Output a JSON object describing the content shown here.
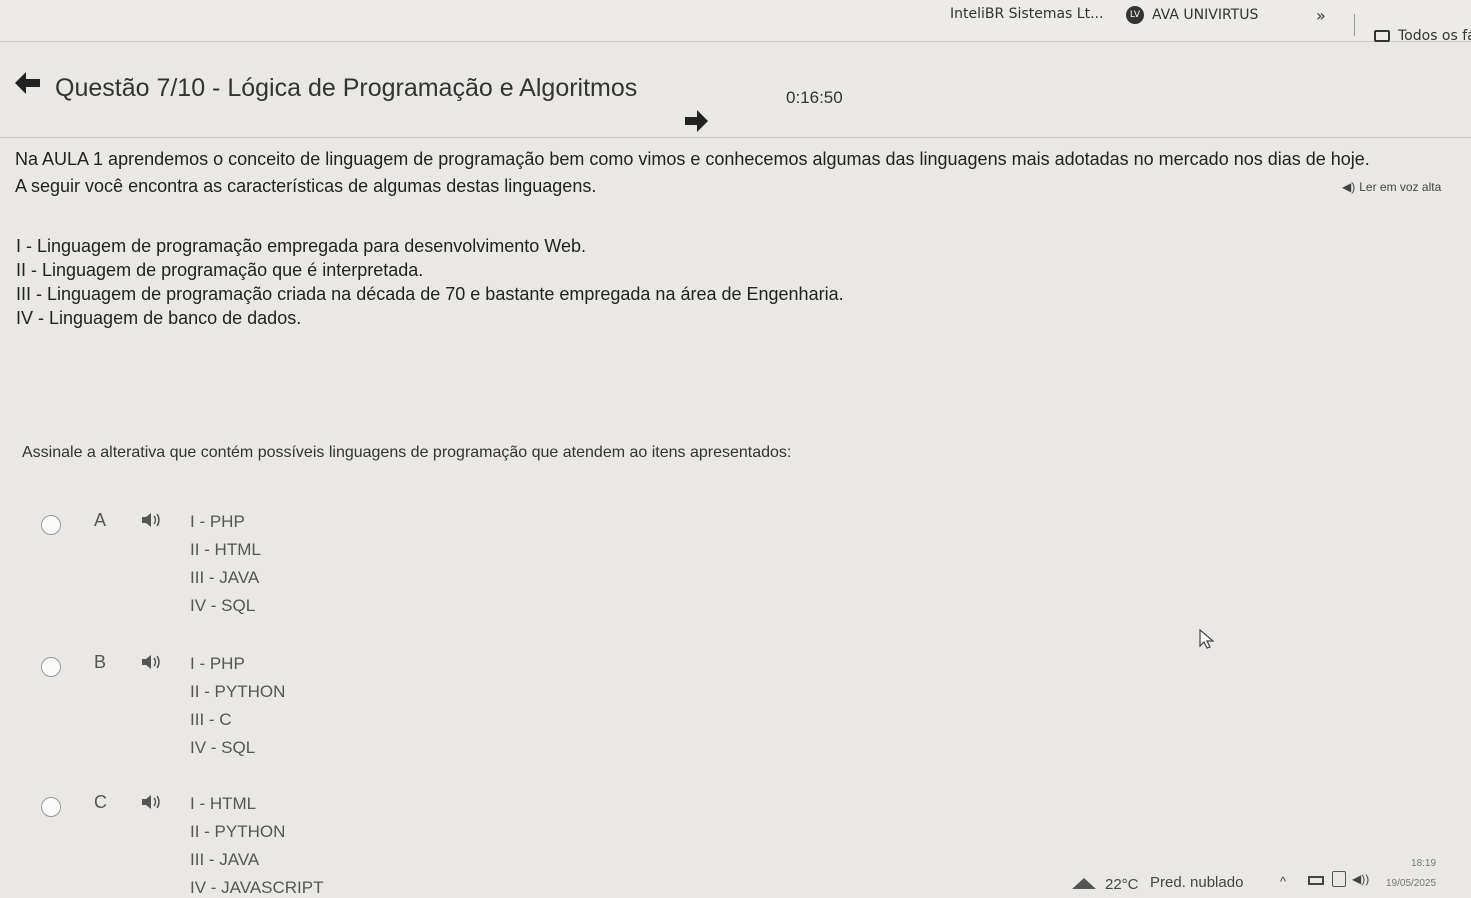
{
  "bookmarks": {
    "item1": "InteliBR Sistemas Lt...",
    "item2_icon": "LV",
    "item2": "AVA UNIVIRTUS",
    "more": "»",
    "item3": "Todos os fa"
  },
  "header": {
    "title": "Questão 7/10 - Lógica de Programação e Algoritmos",
    "timer": "0:16:50"
  },
  "question": {
    "intro_line1": "Na AULA 1 aprendemos o conceito de linguagem de programação bem como vimos e conhecemos algumas das linguagens mais adotadas no mercado nos dias de hoje.",
    "intro_line2": "A seguir você encontra as características de algumas destas linguagens.",
    "tts_label": "Ler em voz alta",
    "items": [
      "I - Linguagem de programação empregada para desenvolvimento Web.",
      "II - Linguagem de programação que é interpretada.",
      "III - Linguagem de programação criada na década de 70 e bastante empregada na área de Engenharia.",
      "IV - Linguagem de banco de dados."
    ],
    "prompt": "Assinale a alterativa que contém possíveis linguagens de programação que atendem ao itens apresentados:"
  },
  "options": [
    {
      "letter": "A",
      "lines": [
        "I - PHP",
        "II - HTML",
        "III - JAVA",
        "IV - SQL"
      ]
    },
    {
      "letter": "B",
      "lines": [
        "I - PHP",
        "II - PYTHON",
        "III - C",
        "IV - SQL"
      ]
    },
    {
      "letter": "C",
      "lines": [
        "I - HTML",
        "II - PYTHON",
        "III - JAVA",
        "IV - JAVASCRIPT"
      ]
    }
  ],
  "taskbar": {
    "temperature": "22°C",
    "weather": "Pred. nublado",
    "time": "18:19",
    "date": "19/05/2025"
  }
}
